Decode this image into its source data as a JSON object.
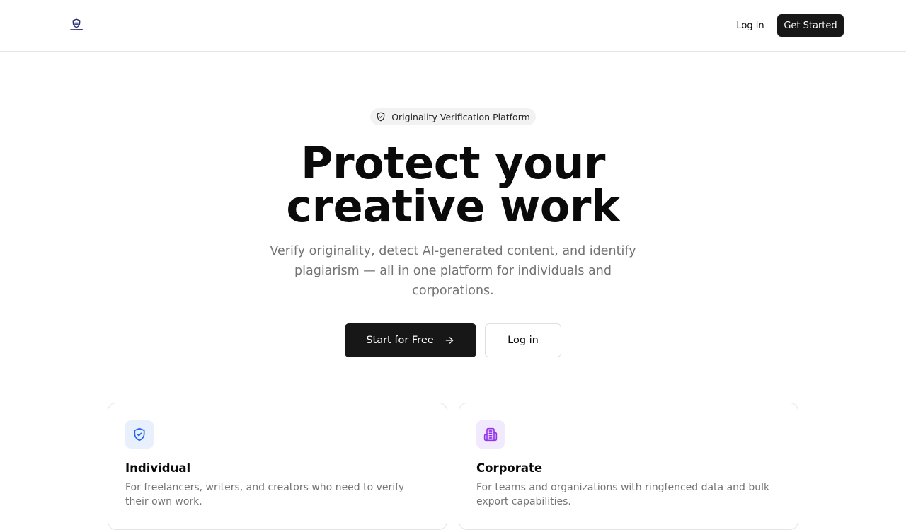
{
  "header": {
    "logo_icon": "shield-logo-icon",
    "login_label": "Log in",
    "cta_label": "Get Started"
  },
  "hero": {
    "badge": {
      "icon": "shield-check-icon",
      "label": "Originality Verification Platform"
    },
    "title_line1": "Protect your",
    "title_line2": "creative work",
    "subtitle": "Verify originality, detect AI-generated content, and identify plagiarism — all in one platform for individuals and corporations.",
    "primary_button": {
      "label": "Start for Free",
      "icon": "arrow-right-icon"
    },
    "secondary_button": {
      "label": "Log in"
    }
  },
  "cards": [
    {
      "icon": "shield-check-icon",
      "icon_color": "#2563eb",
      "icon_bg": "#e8f0fe",
      "title": "Individual",
      "description": "For freelancers, writers, and creators who need to verify their own work."
    },
    {
      "icon": "building-icon",
      "icon_color": "#9333ea",
      "icon_bg": "#f1e9fd",
      "title": "Corporate",
      "description": "For teams and organizations with ringfenced data and bulk export capabilities."
    }
  ],
  "colors": {
    "primary": "#171717",
    "muted_text": "#737373",
    "border": "#e5e5e5"
  }
}
